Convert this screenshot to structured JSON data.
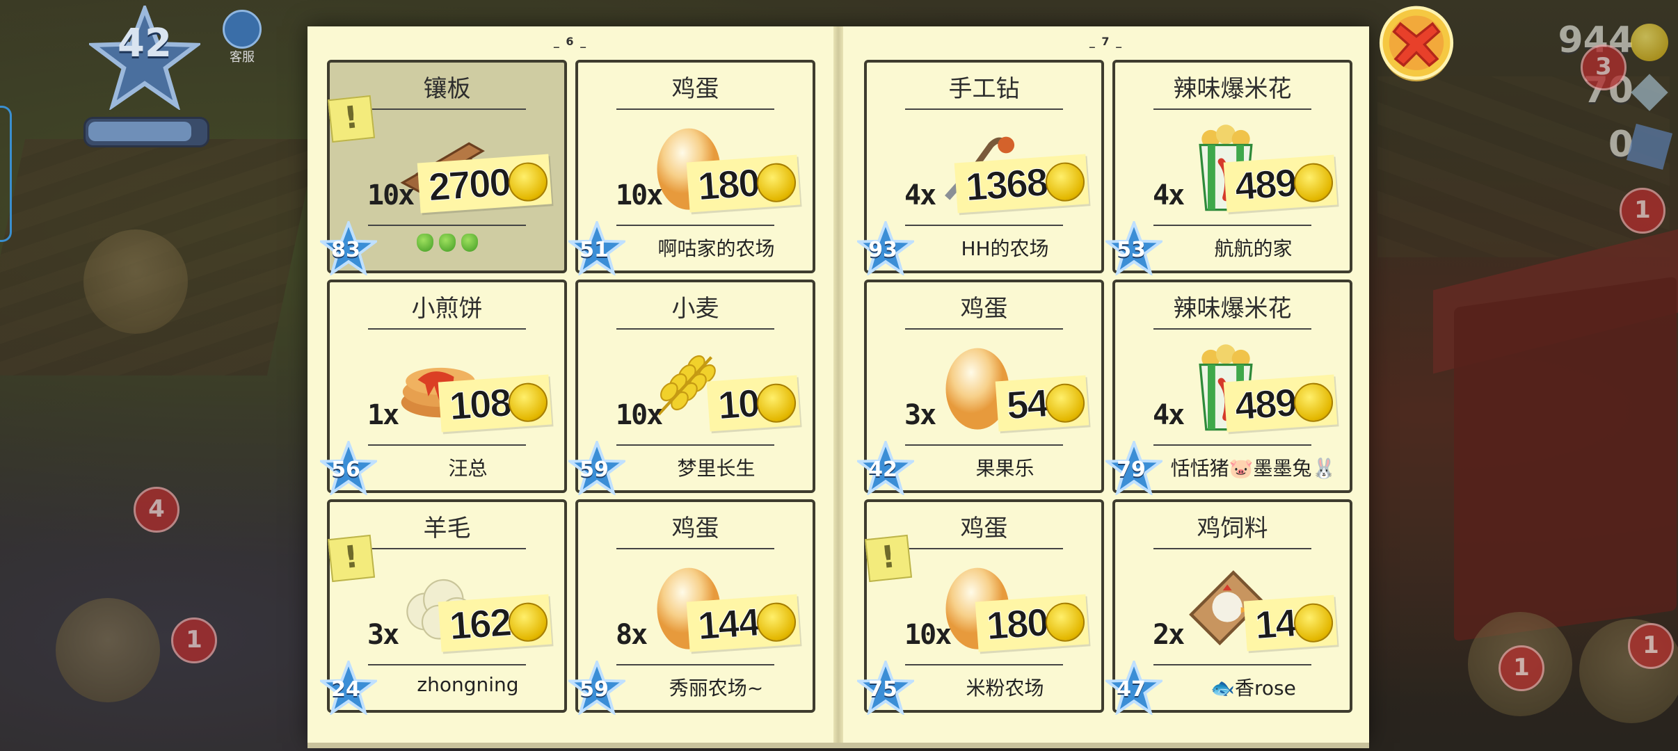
{
  "hud": {
    "level": "42",
    "service_label": "客服",
    "xp_fraction": 0.92,
    "coins": "944",
    "diamonds": "70",
    "vouchers": "0",
    "badges": [
      "3",
      "1",
      "4",
      "1",
      "1",
      "1"
    ]
  },
  "book": {
    "left_page": "6",
    "right_page": "7"
  },
  "colors": {
    "page": "#fbf9d2",
    "sold_card": "#cfcca2",
    "card_border": "#3e3c2e",
    "price_tag": "#fff6a6",
    "close_button": "#e8402a"
  },
  "cards": [
    {
      "title": "镶板",
      "qty": "10x",
      "price": "2700",
      "seller": "",
      "level": "83",
      "item_icon": "planks-icon",
      "sold": true,
      "alert": true
    },
    {
      "title": "鸡蛋",
      "qty": "10x",
      "price": "180",
      "seller": "啊咕家的农场",
      "level": "51",
      "item_icon": "egg-icon",
      "sold": false,
      "alert": false
    },
    {
      "title": "手工钻",
      "qty": "4x",
      "price": "1368",
      "seller": "HH的农场",
      "level": "93",
      "item_icon": "hand-drill-icon",
      "sold": false,
      "alert": false
    },
    {
      "title": "辣味爆米花",
      "qty": "4x",
      "price": "489",
      "seller": "航航的家",
      "level": "53",
      "item_icon": "chili-popcorn-icon",
      "sold": false,
      "alert": false
    },
    {
      "title": "小煎饼",
      "qty": "1x",
      "price": "108",
      "seller": "汪总",
      "level": "56",
      "item_icon": "pancake-icon",
      "sold": false,
      "alert": false
    },
    {
      "title": "小麦",
      "qty": "10x",
      "price": "10",
      "seller": "梦里长生",
      "level": "59",
      "item_icon": "wheat-icon",
      "sold": false,
      "alert": false
    },
    {
      "title": "鸡蛋",
      "qty": "3x",
      "price": "54",
      "seller": "果果乐",
      "level": "42",
      "item_icon": "egg-icon",
      "sold": false,
      "alert": false
    },
    {
      "title": "辣味爆米花",
      "qty": "4x",
      "price": "489",
      "seller": "恬恬猪🐷墨墨兔🐰",
      "level": "79",
      "item_icon": "chili-popcorn-icon",
      "sold": false,
      "alert": false
    },
    {
      "title": "羊毛",
      "qty": "3x",
      "price": "162",
      "seller": "zhongning",
      "level": "24",
      "item_icon": "wool-icon",
      "sold": false,
      "alert": true
    },
    {
      "title": "鸡蛋",
      "qty": "8x",
      "price": "144",
      "seller": "秀丽农场~",
      "level": "59",
      "item_icon": "egg-icon",
      "sold": false,
      "alert": false
    },
    {
      "title": "鸡蛋",
      "qty": "10x",
      "price": "180",
      "seller": "米粉农场",
      "level": "75",
      "item_icon": "egg-icon",
      "sold": false,
      "alert": true
    },
    {
      "title": "鸡饲料",
      "qty": "2x",
      "price": "14",
      "seller": "🐟香rose",
      "level": "47",
      "item_icon": "chicken-feed-icon",
      "sold": false,
      "alert": false
    }
  ]
}
